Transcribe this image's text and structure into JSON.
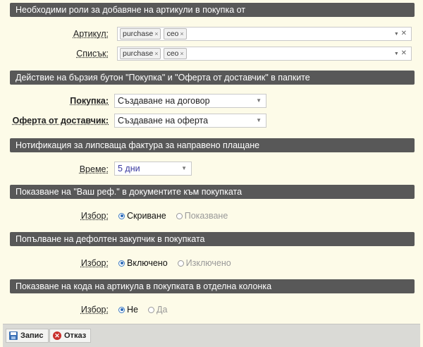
{
  "sections": {
    "roles": {
      "title": "Необходими роли за добавяне на артикули в покупка от",
      "article": {
        "label": "Артикул",
        "tags": [
          "purchase",
          "ceo"
        ]
      },
      "list": {
        "label": "Списък",
        "tags": [
          "purchase",
          "ceo"
        ]
      }
    },
    "quick_button": {
      "title": "Действие на бързия бутон \"Покупка\" и \"Оферта от доставчик\" в папките",
      "purchase": {
        "label": "Покупка",
        "value": "Създаване на договор"
      },
      "offer": {
        "label": "Оферта от доставчик",
        "value": "Създаване на оферта"
      }
    },
    "missing_invoice": {
      "title": "Нотификация за липсваща фактура за направено плащане",
      "time": {
        "label": "Време",
        "value": "5 дни"
      }
    },
    "your_ref": {
      "title": "Показване на \"Ваш реф.\" в документите към покупката",
      "choice": {
        "label": "Избор",
        "options": [
          "Скриване",
          "Показване"
        ],
        "selected": "Скриване"
      }
    },
    "default_buyer": {
      "title": "Попълване на дефолтен закупчик в покупката",
      "choice": {
        "label": "Избор",
        "options": [
          "Включено",
          "Изключено"
        ],
        "selected": "Включено"
      }
    },
    "article_code": {
      "title": "Показване на кода на артикула в покупката в отделна колонка",
      "choice": {
        "label": "Избор",
        "options": [
          "Не",
          "Да"
        ],
        "selected": "Не"
      }
    }
  },
  "footer": {
    "save_label": "Запис",
    "cancel_label": "Отказ"
  },
  "glyphs": {
    "colon": ":",
    "tag_remove": "×",
    "dropdown": "▼",
    "clear": "✕"
  }
}
